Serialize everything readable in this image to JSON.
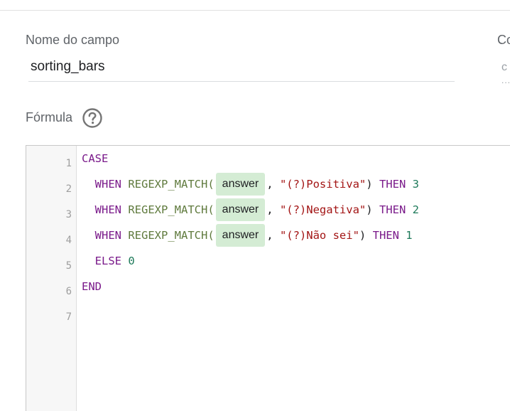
{
  "field": {
    "label": "Nome do campo",
    "value": "sorting_bars"
  },
  "side_field": {
    "label": "Co",
    "placeholder": "c",
    "dots": "..."
  },
  "formula": {
    "label": "Fórmula",
    "help_icon": "question-circle-icon"
  },
  "editor": {
    "line_numbers": [
      "1",
      "2",
      "3",
      "4",
      "5",
      "6",
      "7"
    ],
    "lines": {
      "l1": {
        "kw": "CASE"
      },
      "l2": {
        "when": "WHEN",
        "fn": "REGEXP_MATCH(",
        "chip": "answer",
        "comma": ",",
        "str": "\"(?)Positiva\"",
        "close": ")",
        "then": "THEN",
        "num": "3"
      },
      "l3": {
        "when": "WHEN",
        "fn": "REGEXP_MATCH(",
        "chip": "answer",
        "comma": ",",
        "str": "\"(?)Negativa\"",
        "close": ")",
        "then": "THEN",
        "num": "2"
      },
      "l4": {
        "when": "WHEN",
        "fn": "REGEXP_MATCH(",
        "chip": "answer",
        "comma": ",",
        "str": "\"(?)Não sei\"",
        "close": ")",
        "then": "THEN",
        "num": "1"
      },
      "l5": {
        "kw": "ELSE",
        "num": "0"
      },
      "l6": {
        "kw": "END"
      }
    }
  }
}
